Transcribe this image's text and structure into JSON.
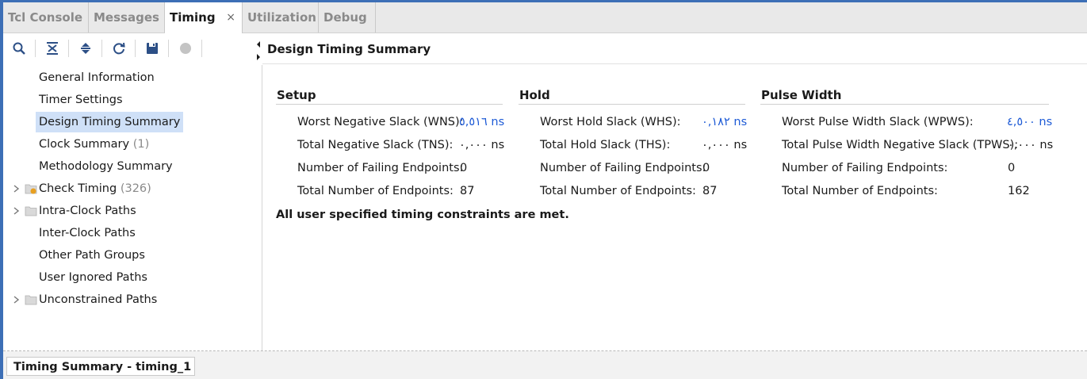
{
  "tabs": [
    {
      "label": "Tcl Console"
    },
    {
      "label": "Messages"
    },
    {
      "label": "Timing",
      "close": "×"
    },
    {
      "label": "Utilization"
    },
    {
      "label": "Debug"
    }
  ],
  "toolbar": {
    "icons": [
      "search-icon",
      "collapse-all-icon",
      "expand-all-icon",
      "refresh-icon",
      "save-icon",
      "stop-icon"
    ]
  },
  "tree": {
    "items": [
      {
        "label": "General Information"
      },
      {
        "label": "Timer Settings"
      },
      {
        "label": "Design Timing Summary"
      },
      {
        "label": "Clock Summary",
        "count": "(1)"
      },
      {
        "label": "Methodology Summary"
      },
      {
        "label": "Check Timing",
        "count": "(326)"
      },
      {
        "label": "Intra-Clock Paths"
      },
      {
        "label": "Inter-Clock Paths"
      },
      {
        "label": "Other Path Groups"
      },
      {
        "label": "User Ignored Paths"
      },
      {
        "label": "Unconstrained Paths"
      }
    ]
  },
  "panel": {
    "title": "Design Timing Summary",
    "setup": {
      "heading": "Setup",
      "rows": [
        {
          "label": "Worst Negative Slack (WNS):",
          "value": "٥,٥١٦ ns"
        },
        {
          "label": "Total Negative Slack (TNS):",
          "value": "٠,٠٠٠ ns"
        },
        {
          "label": "Number of Failing Endpoints:",
          "value": "0"
        },
        {
          "label": "Total Number of Endpoints:",
          "value": "87"
        }
      ]
    },
    "hold": {
      "heading": "Hold",
      "rows": [
        {
          "label": "Worst Hold Slack (WHS):",
          "value": "٠,١٨٢ ns"
        },
        {
          "label": "Total Hold Slack (THS):",
          "value": "٠,٠٠٠ ns"
        },
        {
          "label": "Number of Failing Endpoints:",
          "value": "0"
        },
        {
          "label": "Total Number of Endpoints:",
          "value": "87"
        }
      ]
    },
    "pulse": {
      "heading": "Pulse Width",
      "rows": [
        {
          "label": "Worst Pulse Width Slack (WPWS):",
          "value": "٤,٥٠٠ ns"
        },
        {
          "label": "Total Pulse Width Negative Slack (TPWS):",
          "value": "٠,٠٠٠ ns"
        },
        {
          "label": "Number of Failing Endpoints:",
          "value": "0"
        },
        {
          "label": "Total Number of Endpoints:",
          "value": "162"
        }
      ]
    },
    "status": "All user specified timing constraints are met."
  },
  "bottom": {
    "tab_label": "Timing Summary - timing_1"
  },
  "colors": {
    "accent": "#3d6fb6",
    "link": "#1e5bd6",
    "selection": "#cfe0f7"
  }
}
